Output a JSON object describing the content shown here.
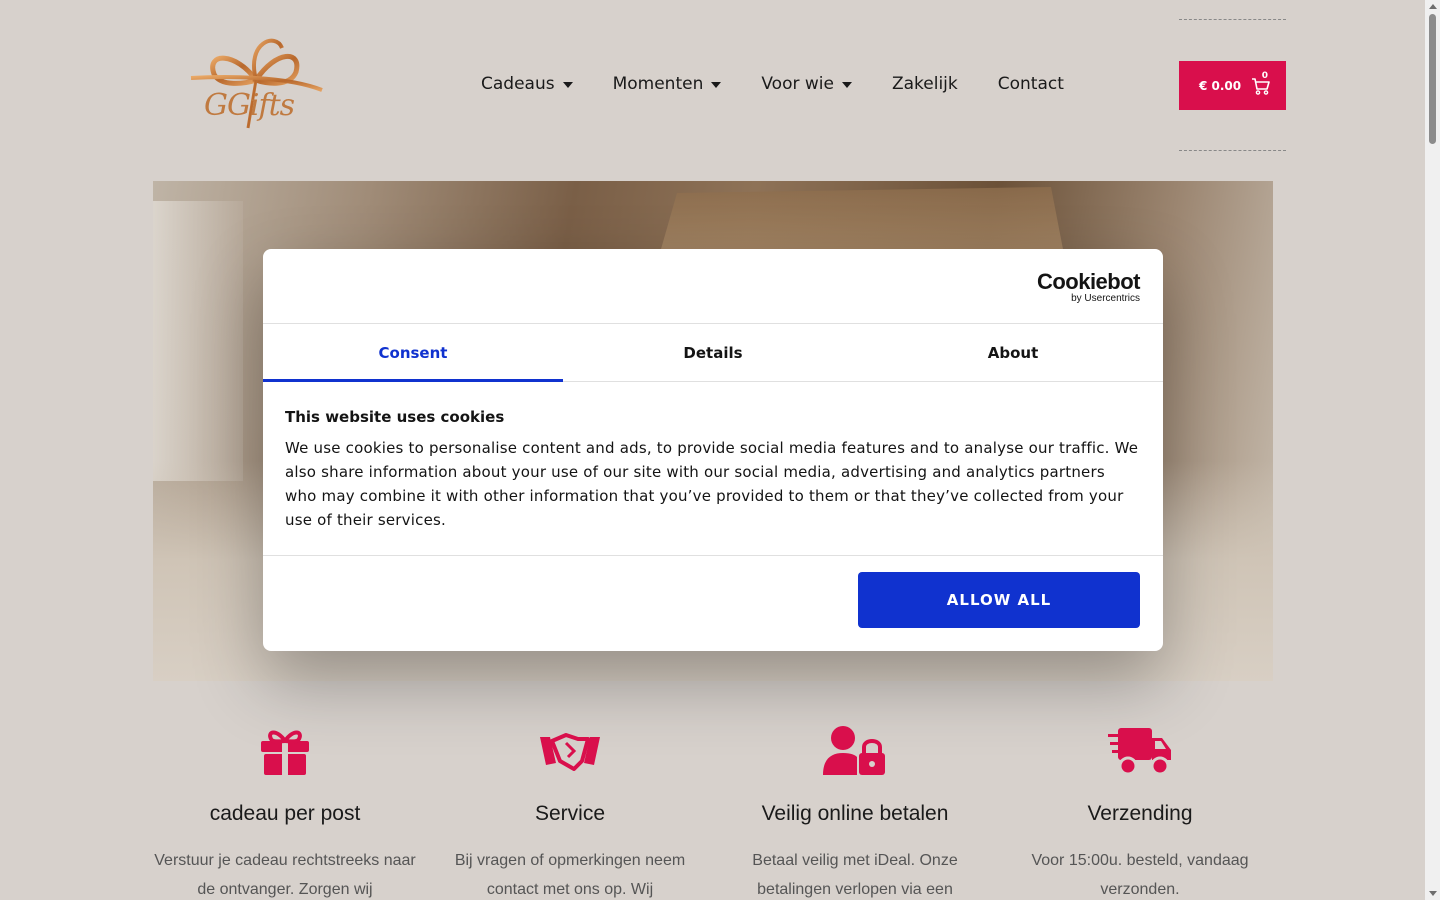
{
  "header": {
    "logo_text": "GGifts",
    "nav": [
      {
        "label": "Cadeaus",
        "has_dropdown": true
      },
      {
        "label": "Momenten",
        "has_dropdown": true
      },
      {
        "label": "Voor wie",
        "has_dropdown": true
      },
      {
        "label": "Zakelijk",
        "has_dropdown": false
      },
      {
        "label": "Contact",
        "has_dropdown": false
      }
    ],
    "cart": {
      "total": "€ 0.00",
      "count": "0",
      "icon": "cart-icon"
    }
  },
  "cookie_dialog": {
    "brand": "Cookiebot",
    "brand_sub": "by Usercentrics",
    "tabs": [
      {
        "label": "Consent",
        "active": true
      },
      {
        "label": "Details",
        "active": false
      },
      {
        "label": "About",
        "active": false
      }
    ],
    "title": "This website uses cookies",
    "text": "We use cookies to personalise content and ads, to provide social media features and to analyse our traffic. We also share information about your use of our site with our social media, advertising and analytics partners who may combine it with other information that you’ve provided to them or that they’ve collected from your use of their services.",
    "allow_label": "ALLOW ALL"
  },
  "features": [
    {
      "icon": "gift-icon",
      "title": "cadeau per post",
      "text": "Verstuur je cadeau rechtstreeks naar de ontvanger. Zorgen wij"
    },
    {
      "icon": "handshake-icon",
      "title": "Service",
      "text": "Bij vragen of opmerkingen neem contact met ons op. Wij"
    },
    {
      "icon": "user-lock-icon",
      "title": "Veilig online betalen",
      "text": "Betaal veilig met iDeal. Onze betalingen verlopen via een"
    },
    {
      "icon": "delivery-truck-icon",
      "title": "Verzending",
      "text": "Voor 15:00u. besteld, vandaag verzonden."
    }
  ],
  "colors": {
    "background": "#d7d1cc",
    "accent": "#d90f4c",
    "consent_blue": "#1032cf",
    "logo_copper": "#c07a40"
  }
}
